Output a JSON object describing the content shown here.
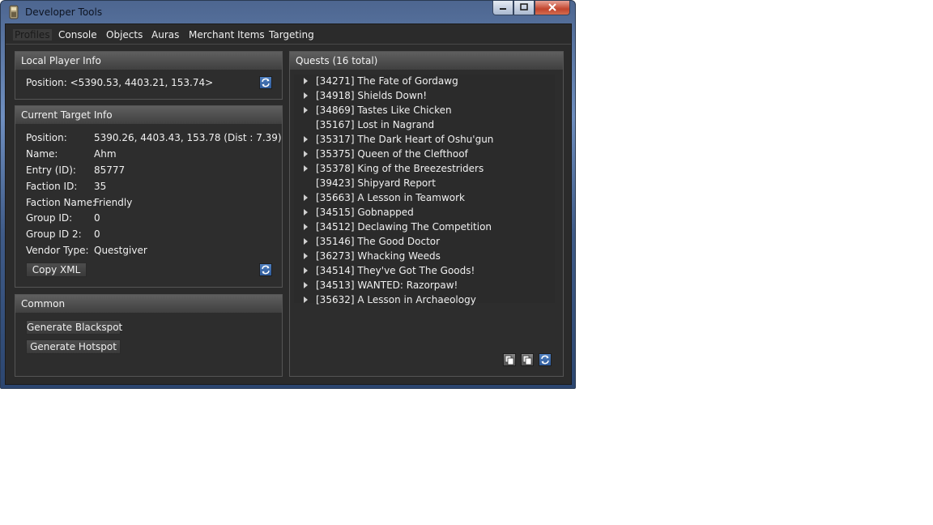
{
  "window": {
    "title": "Developer Tools",
    "minimize": "▬",
    "maximize": "▢",
    "close": "✕"
  },
  "menu": [
    "Profiles",
    "Console",
    "Objects",
    "Auras",
    "Merchant Items",
    "Targeting"
  ],
  "local_player": {
    "title": "Local Player Info",
    "position": "Position: <5390.53, 4403.21, 153.74>"
  },
  "current_target": {
    "title": "Current Target Info",
    "fields": [
      {
        "label": "Position:",
        "value": "5390.26, 4403.43, 153.78 (Dist : 7.39)"
      },
      {
        "label": "Name:",
        "value": "Ahm"
      },
      {
        "label": "Entry (ID):",
        "value": "85777"
      },
      {
        "label": "Faction ID:",
        "value": "35"
      },
      {
        "label": "Faction Name:",
        "value": "Friendly"
      },
      {
        "label": "Group ID:",
        "value": "0"
      },
      {
        "label": "Group ID 2:",
        "value": "0"
      },
      {
        "label": "Vendor Type:",
        "value": "Questgiver"
      }
    ],
    "copy_button": "Copy XML"
  },
  "common": {
    "title": "Common",
    "blackspot_button": "Generate Blackspot",
    "hotspot_button": "Generate Hotspot"
  },
  "quests": {
    "title": "Quests (16 total)",
    "items": [
      {
        "text": "[34271] The Fate of Gordawg",
        "expandable": true
      },
      {
        "text": "[34918] Shields Down!",
        "expandable": true
      },
      {
        "text": "[34869] Tastes Like Chicken",
        "expandable": true
      },
      {
        "text": "[35167] Lost in Nagrand",
        "expandable": false
      },
      {
        "text": "[35317] The Dark Heart of Oshu'gun",
        "expandable": true
      },
      {
        "text": "[35375] Queen of the Clefthoof",
        "expandable": true
      },
      {
        "text": "[35378] King of the Breezestriders",
        "expandable": true
      },
      {
        "text": "[39423] Shipyard Report",
        "expandable": false
      },
      {
        "text": "[35663] A Lesson in Teamwork",
        "expandable": true
      },
      {
        "text": "[34515] Gobnapped",
        "expandable": true
      },
      {
        "text": "[34512] Declawing The Competition",
        "expandable": true
      },
      {
        "text": "[35146] The Good Doctor",
        "expandable": true
      },
      {
        "text": "[36273] Whacking Weeds",
        "expandable": true
      },
      {
        "text": "[34514] They've Got The Goods!",
        "expandable": true
      },
      {
        "text": "[34513] WANTED: Razorpaw!",
        "expandable": true
      },
      {
        "text": "[35632] A Lesson in Archaeology",
        "expandable": true
      }
    ]
  },
  "icons": {
    "refresh": "refresh-icon",
    "copy": "copy-icon",
    "app": "app-icon"
  }
}
